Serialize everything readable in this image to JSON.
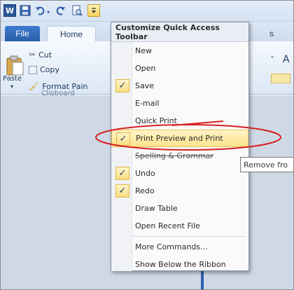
{
  "qat": {
    "word_icon_label": "W",
    "icons": [
      "word-icon",
      "save-icon",
      "undo-icon",
      "redo-icon",
      "print-preview-icon",
      "customize-qat-icon"
    ]
  },
  "tabs": {
    "file": "File",
    "home": "Home",
    "partial": "s"
  },
  "ribbon": {
    "paste_label": "Paste",
    "cut_label": "Cut",
    "copy_label": "Copy",
    "format_painter_label": "Format Pain",
    "group_label": "Clipboard",
    "right_glyph_a": "ˇ",
    "right_glyph_b": "A"
  },
  "menu": {
    "title": "Customize Quick Access Toolbar",
    "items": [
      {
        "label": "New",
        "checked": false
      },
      {
        "label": "Open",
        "checked": false
      },
      {
        "label": "Save",
        "checked": true
      },
      {
        "label": "E-mail",
        "checked": false
      },
      {
        "label": "Quick Print",
        "checked": false
      },
      {
        "label": "Print Preview and Print",
        "checked": true,
        "highlighted": true
      },
      {
        "label": "Spelling & Grammar",
        "checked": false
      },
      {
        "label": "Undo",
        "checked": true
      },
      {
        "label": "Redo",
        "checked": true
      },
      {
        "label": "Draw Table",
        "checked": false
      },
      {
        "label": "Open Recent File",
        "checked": false
      }
    ],
    "more_commands": "More Commands...",
    "show_below": "Show Below the Ribbon",
    "check_glyph": "✓"
  },
  "tooltip": {
    "text": "Remove fro"
  },
  "colors": {
    "accent": "#2b579a",
    "highlight": "#fbe38c",
    "annotation": "#d62020"
  }
}
